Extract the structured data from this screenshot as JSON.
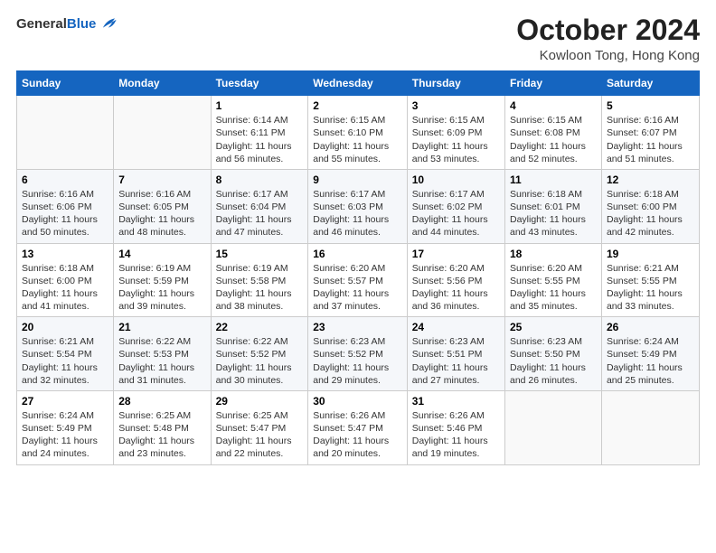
{
  "logo": {
    "general": "General",
    "blue": "Blue"
  },
  "title": "October 2024",
  "location": "Kowloon Tong, Hong Kong",
  "weekdays": [
    "Sunday",
    "Monday",
    "Tuesday",
    "Wednesday",
    "Thursday",
    "Friday",
    "Saturday"
  ],
  "weeks": [
    [
      {
        "day": "",
        "info": ""
      },
      {
        "day": "",
        "info": ""
      },
      {
        "day": "1",
        "info": "Sunrise: 6:14 AM\nSunset: 6:11 PM\nDaylight: 11 hours and 56 minutes."
      },
      {
        "day": "2",
        "info": "Sunrise: 6:15 AM\nSunset: 6:10 PM\nDaylight: 11 hours and 55 minutes."
      },
      {
        "day": "3",
        "info": "Sunrise: 6:15 AM\nSunset: 6:09 PM\nDaylight: 11 hours and 53 minutes."
      },
      {
        "day": "4",
        "info": "Sunrise: 6:15 AM\nSunset: 6:08 PM\nDaylight: 11 hours and 52 minutes."
      },
      {
        "day": "5",
        "info": "Sunrise: 6:16 AM\nSunset: 6:07 PM\nDaylight: 11 hours and 51 minutes."
      }
    ],
    [
      {
        "day": "6",
        "info": "Sunrise: 6:16 AM\nSunset: 6:06 PM\nDaylight: 11 hours and 50 minutes."
      },
      {
        "day": "7",
        "info": "Sunrise: 6:16 AM\nSunset: 6:05 PM\nDaylight: 11 hours and 48 minutes."
      },
      {
        "day": "8",
        "info": "Sunrise: 6:17 AM\nSunset: 6:04 PM\nDaylight: 11 hours and 47 minutes."
      },
      {
        "day": "9",
        "info": "Sunrise: 6:17 AM\nSunset: 6:03 PM\nDaylight: 11 hours and 46 minutes."
      },
      {
        "day": "10",
        "info": "Sunrise: 6:17 AM\nSunset: 6:02 PM\nDaylight: 11 hours and 44 minutes."
      },
      {
        "day": "11",
        "info": "Sunrise: 6:18 AM\nSunset: 6:01 PM\nDaylight: 11 hours and 43 minutes."
      },
      {
        "day": "12",
        "info": "Sunrise: 6:18 AM\nSunset: 6:00 PM\nDaylight: 11 hours and 42 minutes."
      }
    ],
    [
      {
        "day": "13",
        "info": "Sunrise: 6:18 AM\nSunset: 6:00 PM\nDaylight: 11 hours and 41 minutes."
      },
      {
        "day": "14",
        "info": "Sunrise: 6:19 AM\nSunset: 5:59 PM\nDaylight: 11 hours and 39 minutes."
      },
      {
        "day": "15",
        "info": "Sunrise: 6:19 AM\nSunset: 5:58 PM\nDaylight: 11 hours and 38 minutes."
      },
      {
        "day": "16",
        "info": "Sunrise: 6:20 AM\nSunset: 5:57 PM\nDaylight: 11 hours and 37 minutes."
      },
      {
        "day": "17",
        "info": "Sunrise: 6:20 AM\nSunset: 5:56 PM\nDaylight: 11 hours and 36 minutes."
      },
      {
        "day": "18",
        "info": "Sunrise: 6:20 AM\nSunset: 5:55 PM\nDaylight: 11 hours and 35 minutes."
      },
      {
        "day": "19",
        "info": "Sunrise: 6:21 AM\nSunset: 5:55 PM\nDaylight: 11 hours and 33 minutes."
      }
    ],
    [
      {
        "day": "20",
        "info": "Sunrise: 6:21 AM\nSunset: 5:54 PM\nDaylight: 11 hours and 32 minutes."
      },
      {
        "day": "21",
        "info": "Sunrise: 6:22 AM\nSunset: 5:53 PM\nDaylight: 11 hours and 31 minutes."
      },
      {
        "day": "22",
        "info": "Sunrise: 6:22 AM\nSunset: 5:52 PM\nDaylight: 11 hours and 30 minutes."
      },
      {
        "day": "23",
        "info": "Sunrise: 6:23 AM\nSunset: 5:52 PM\nDaylight: 11 hours and 29 minutes."
      },
      {
        "day": "24",
        "info": "Sunrise: 6:23 AM\nSunset: 5:51 PM\nDaylight: 11 hours and 27 minutes."
      },
      {
        "day": "25",
        "info": "Sunrise: 6:23 AM\nSunset: 5:50 PM\nDaylight: 11 hours and 26 minutes."
      },
      {
        "day": "26",
        "info": "Sunrise: 6:24 AM\nSunset: 5:49 PM\nDaylight: 11 hours and 25 minutes."
      }
    ],
    [
      {
        "day": "27",
        "info": "Sunrise: 6:24 AM\nSunset: 5:49 PM\nDaylight: 11 hours and 24 minutes."
      },
      {
        "day": "28",
        "info": "Sunrise: 6:25 AM\nSunset: 5:48 PM\nDaylight: 11 hours and 23 minutes."
      },
      {
        "day": "29",
        "info": "Sunrise: 6:25 AM\nSunset: 5:47 PM\nDaylight: 11 hours and 22 minutes."
      },
      {
        "day": "30",
        "info": "Sunrise: 6:26 AM\nSunset: 5:47 PM\nDaylight: 11 hours and 20 minutes."
      },
      {
        "day": "31",
        "info": "Sunrise: 6:26 AM\nSunset: 5:46 PM\nDaylight: 11 hours and 19 minutes."
      },
      {
        "day": "",
        "info": ""
      },
      {
        "day": "",
        "info": ""
      }
    ]
  ]
}
